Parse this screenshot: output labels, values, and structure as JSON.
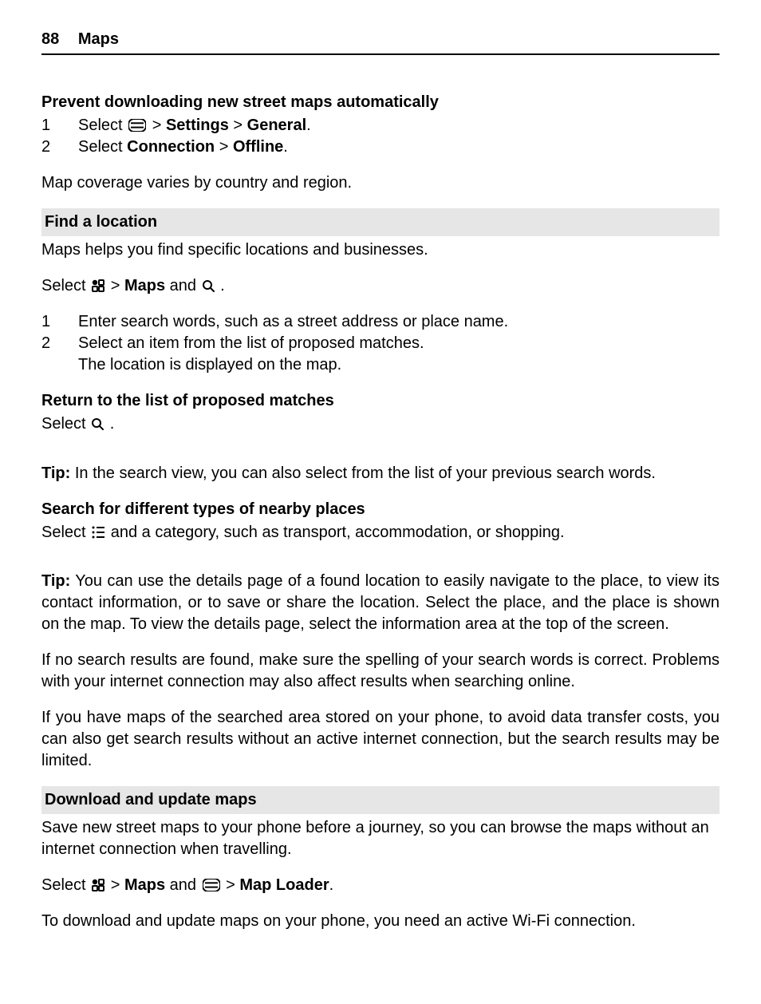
{
  "header": {
    "page": "88",
    "title": "Maps"
  },
  "sec_a": {
    "title": "Prevent downloading new street maps automatically",
    "step1_a": "Select ",
    "step1_b": " > ",
    "step1_c": "Settings",
    "step1_d": "  > ",
    "step1_e": "General",
    "step1_f": ".",
    "step2_a": "Select ",
    "step2_b": "Connection",
    "step2_c": "  > ",
    "step2_d": "Offline",
    "step2_e": ".",
    "para": "Map coverage varies by country and region."
  },
  "sec_b": {
    "bar": "Find a location",
    "intro": "Maps helps you find specific locations and businesses.",
    "sel_a": "Select ",
    "sel_b": "  > ",
    "sel_c": "Maps",
    "sel_d": " and ",
    "sel_e": " .",
    "s1": "Enter search words, such as a street address or place name.",
    "s2": "Select an item from the list of proposed matches.",
    "s2b": "The location is displayed on the map."
  },
  "sec_c": {
    "title": "Return to the list of proposed matches",
    "line_a": "Select ",
    "line_b": " ."
  },
  "sec_d": {
    "tip": "Tip:",
    "text": " In the search view, you can also select from the list of your previous search words."
  },
  "sec_e": {
    "title": "Search for different types of nearby places",
    "line_a": "Select  ",
    "line_b": "  and a category, such as transport, accommodation, or shopping."
  },
  "sec_f": {
    "tip": "Tip:",
    "text": " You can use the details page of a found location to easily navigate to the place, to view its contact information, or to save or share the location. Select the place, and the place is shown on the map. To view the details page, select the information area at the top of the screen."
  },
  "sec_g": "If no search results are found, make sure the spelling of your search words is correct. Problems with your internet connection may also affect results when searching online.",
  "sec_h": "If you have maps of the searched area stored on your phone, to avoid data transfer costs, you can also get search results without an active internet connection, but the search results may be limited.",
  "sec_i": {
    "bar": "Download and update maps",
    "intro": "Save new street maps to your phone before a journey, so you can browse the maps without an internet connection when travelling.",
    "sel_a": "Select ",
    "sel_b": "  > ",
    "sel_c": "Maps",
    "sel_d": " and ",
    "sel_e": "  > ",
    "sel_f": "Map Loader",
    "sel_g": ".",
    "outro": "To download and update maps on your phone, you need an active Wi-Fi connection."
  },
  "nums": {
    "one": "1",
    "two": "2"
  }
}
